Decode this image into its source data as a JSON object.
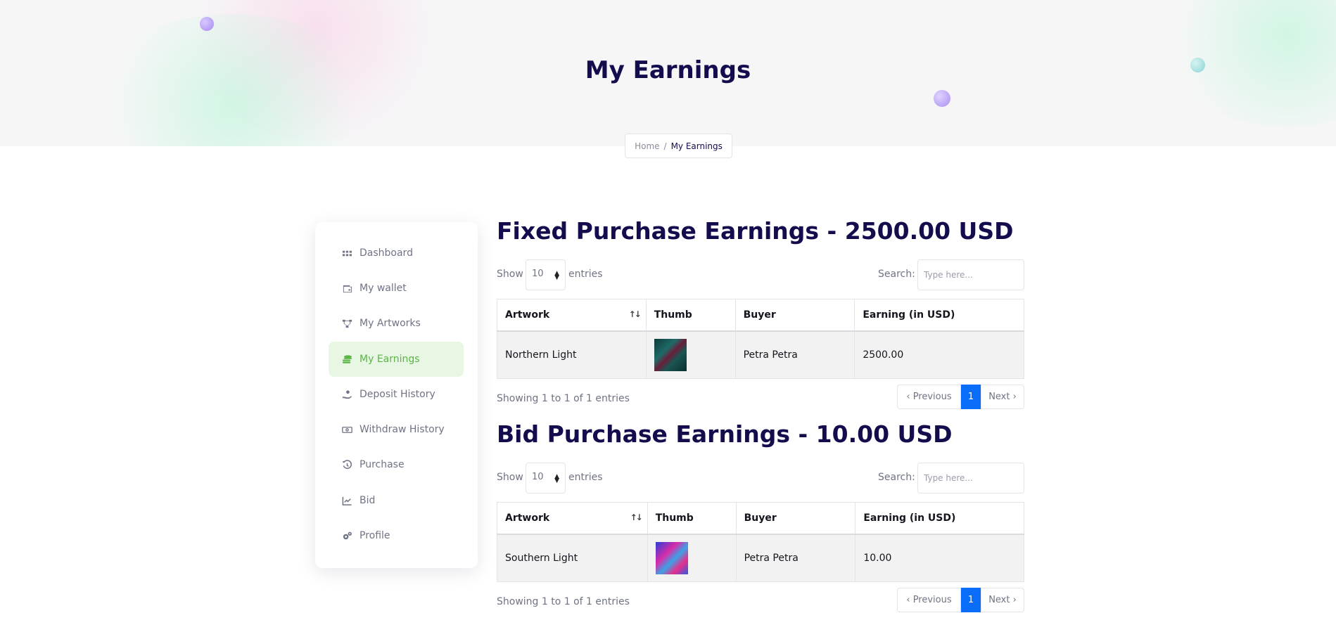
{
  "hero": {
    "title": "My Earnings",
    "breadcrumb": {
      "home": "Home",
      "separator": "/",
      "current": "My Earnings"
    }
  },
  "sidebar": {
    "items": [
      {
        "label": "Dashboard",
        "icon": "grid-icon",
        "active": false
      },
      {
        "label": "My wallet",
        "icon": "wallet-icon",
        "active": false
      },
      {
        "label": "My Artworks",
        "icon": "sitemap-icon",
        "active": false
      },
      {
        "label": "My Earnings",
        "icon": "coins-icon",
        "active": true
      },
      {
        "label": "Deposit History",
        "icon": "hand-coin-icon",
        "active": false
      },
      {
        "label": "Withdraw History",
        "icon": "money-bill-icon",
        "active": false
      },
      {
        "label": "Purchase",
        "icon": "history-icon",
        "active": false
      },
      {
        "label": "Bid",
        "icon": "chart-line-icon",
        "active": false
      },
      {
        "label": "Profile",
        "icon": "gears-icon",
        "active": false
      }
    ],
    "active_color": "#5bb545"
  },
  "fixed": {
    "title": "Fixed Purchase Earnings - 2500.00 USD",
    "show_label": "Show",
    "entries_select": "10",
    "entries_label": "entries",
    "search_label": "Search:",
    "search_placeholder": "Type here...",
    "columns": [
      "Artwork",
      "Thumb",
      "Buyer",
      "Earning (in USD)"
    ],
    "rows": [
      {
        "artwork": "Northern Light",
        "buyer": "Petra Petra",
        "earning": "2500.00"
      }
    ],
    "info": "Showing 1 to 1 of 1 entries",
    "pager": {
      "prev": "‹ Previous",
      "page": "1",
      "next": "Next ›"
    }
  },
  "bid": {
    "title": "Bid Purchase Earnings - 10.00 USD",
    "show_label": "Show",
    "entries_select": "10",
    "entries_label": "entries",
    "search_label": "Search:",
    "search_placeholder": "Type here...",
    "columns": [
      "Artwork",
      "Thumb",
      "Buyer",
      "Earning (in USD)"
    ],
    "rows": [
      {
        "artwork": "Southern Light",
        "buyer": "Petra Petra",
        "earning": "10.00"
      }
    ],
    "info": "Showing 1 to 1 of 1 entries",
    "pager": {
      "prev": "‹ Previous",
      "page": "1",
      "next": "Next ›"
    }
  },
  "colors": {
    "heading": "#130c4d",
    "pager_active": "#0a6dfa"
  }
}
